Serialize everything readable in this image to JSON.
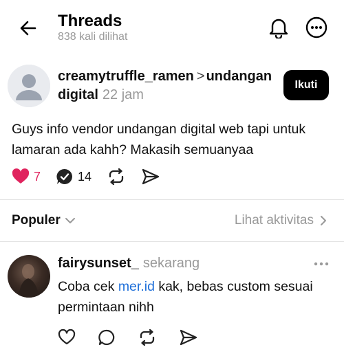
{
  "header": {
    "title": "Threads",
    "views": "838 kali dilihat"
  },
  "post": {
    "username": "creamytruffle_ramen",
    "topic_chevron": ">",
    "topic": "undangan digital",
    "time": "22 jam",
    "follow_label": "Ikuti",
    "text": "Guys info vendor undangan digital web tapi untuk lamaran ada kahh? Makasih semuanyaa",
    "likes": "7",
    "replies": "14"
  },
  "sort": {
    "label": "Populer",
    "activity_label": "Lihat aktivitas"
  },
  "reply": {
    "username": "fairysunset_",
    "time": "sekarang",
    "text_before": "Coba cek ",
    "link": "mer.id",
    "text_after": " kak, bebas custom sesuai permintaan nihh"
  },
  "colors": {
    "like_red": "#e0245e",
    "link_blue": "#1e6fd9",
    "muted_gray": "#999999"
  },
  "icons": [
    "back-arrow-icon",
    "bell-icon",
    "more-icon",
    "heart-filled-icon",
    "reply-badge-icon",
    "repost-icon",
    "send-icon",
    "chevron-down-icon",
    "chevron-right-icon",
    "heart-outline-icon",
    "comment-icon"
  ]
}
